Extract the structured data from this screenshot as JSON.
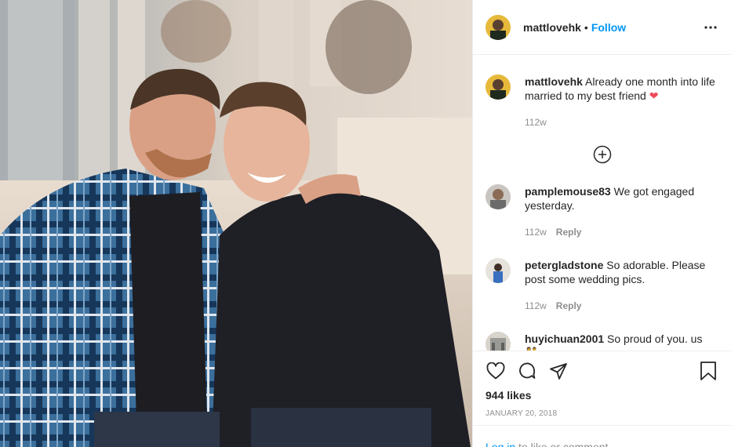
{
  "post": {
    "author": "mattlovehk",
    "follow_label": "Follow",
    "dot": "•",
    "likes": "944 likes",
    "date": "JANUARY 20, 2018"
  },
  "comments": [
    {
      "username": "mattlovehk",
      "text": "Already one month into life married to my best friend",
      "emoji": "❤",
      "time": "112w",
      "reply": ""
    },
    {
      "username": "pamplemouse83",
      "text": "We got engaged yesterday.",
      "time": "112w",
      "reply": "Reply"
    },
    {
      "username": "petergladstone",
      "text": "So adorable. Please post some wedding pics.",
      "time": "112w",
      "reply": "Reply"
    },
    {
      "username": "huyichuan2001",
      "text": "So proud of you. us",
      "emoji": "👫",
      "time": "",
      "reply": ""
    }
  ],
  "login": {
    "link": "Log in",
    "rest": "to like or comment."
  },
  "colors": {
    "accent": "#0095f6",
    "text": "#262626",
    "muted": "#8e8e8e",
    "heart": "#ed4956"
  },
  "icons": [
    "more-options-icon",
    "load-more-icon",
    "heart-icon",
    "comment-icon",
    "share-icon",
    "bookmark-icon"
  ]
}
